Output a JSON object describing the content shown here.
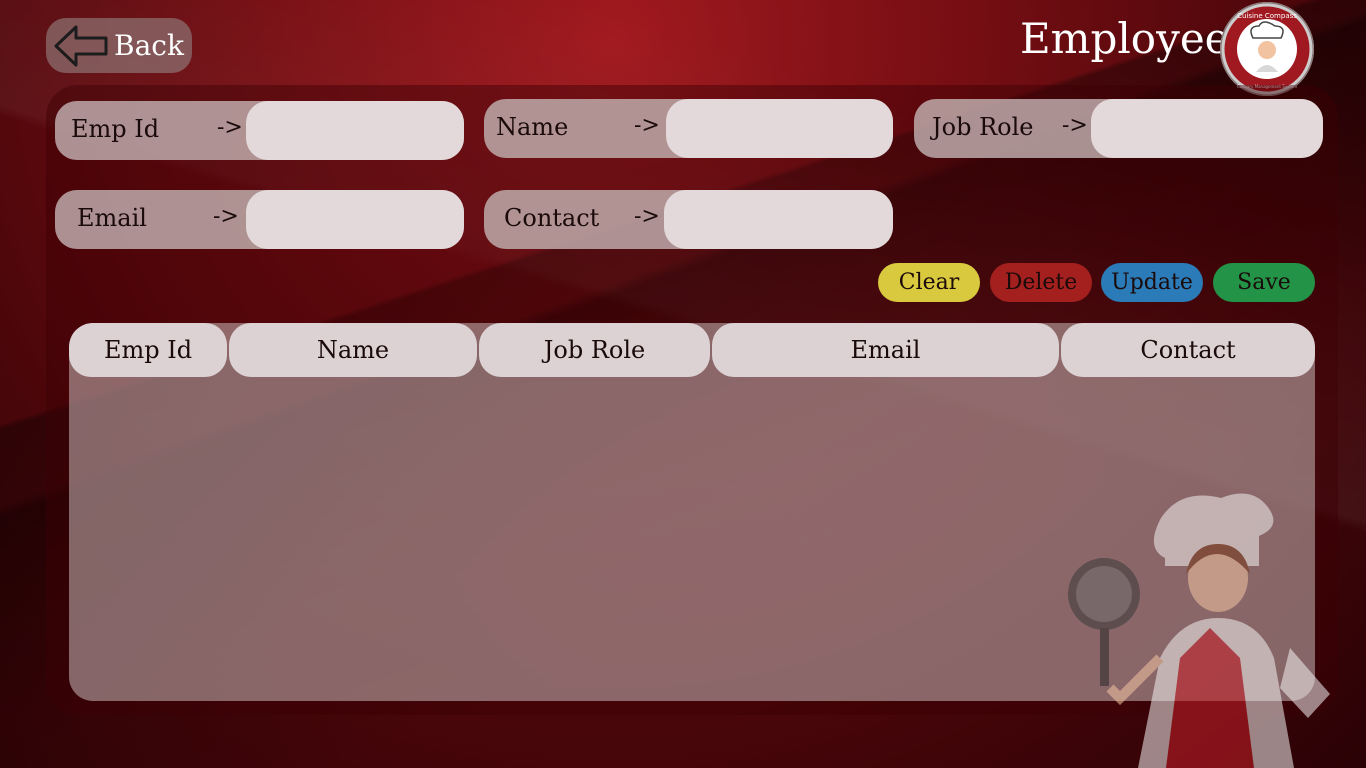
{
  "header": {
    "back_label": "Back",
    "title": "Employee",
    "logo_text": "Cuisine Compass",
    "logo_subtext": "Culinary Management System"
  },
  "form": {
    "emp_id": {
      "label": "Emp Id",
      "arrow": "->",
      "value": ""
    },
    "name": {
      "label": "Name",
      "arrow": "->",
      "value": ""
    },
    "job_role": {
      "label": "Job Role",
      "arrow": "->",
      "value": ""
    },
    "email": {
      "label": "Email",
      "arrow": "->",
      "value": ""
    },
    "contact": {
      "label": "Contact",
      "arrow": "->",
      "value": ""
    }
  },
  "actions": {
    "clear": {
      "label": "Clear",
      "color": "#d9c93e"
    },
    "delete": {
      "label": "Delete",
      "color": "#a4201f"
    },
    "update": {
      "label": "Update",
      "color": "#2b7bb8"
    },
    "save": {
      "label": "Save",
      "color": "#239447"
    }
  },
  "table": {
    "columns": [
      "Emp Id",
      "Name",
      "Job Role",
      "Email",
      "Contact"
    ],
    "rows": []
  },
  "colors": {
    "background": "#7a0f14",
    "field_bg": "#bfaaaa",
    "input_bg": "#e4d9da",
    "header_bg": "#ddd2d3"
  }
}
